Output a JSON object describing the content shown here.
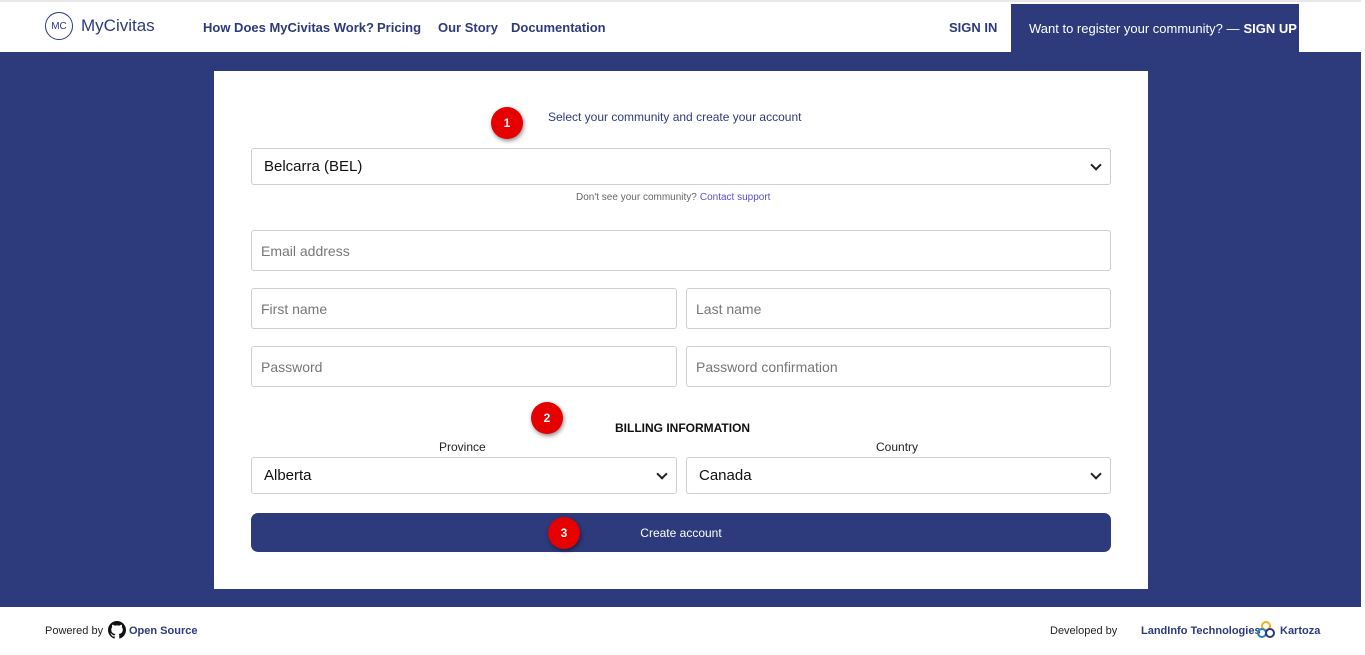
{
  "header": {
    "logo_initials": "MC",
    "logo_text": "MyCivitas",
    "nav": [
      "How Does MyCivitas Work?",
      "Pricing",
      "Our Story",
      "Documentation"
    ],
    "signin": "SIGN IN",
    "signup_prompt": "Want to register your community? —",
    "signup_label": "SIGN UP"
  },
  "form": {
    "badge1": "1",
    "badge2": "2",
    "badge3": "3",
    "title": "Select your community and create your account",
    "community_selected": "Belcarra (BEL)",
    "hint_text": "Don't see your community?",
    "hint_link": "Contact support",
    "email_placeholder": "Email address",
    "first_name_placeholder": "First name",
    "last_name_placeholder": "Last name",
    "password_placeholder": "Password",
    "password_confirm_placeholder": "Password confirmation",
    "billing_title": "BILLING INFORMATION",
    "province_label": "Province",
    "province_selected": "Alberta",
    "country_label": "Country",
    "country_selected": "Canada",
    "submit_label": "Create account"
  },
  "footer": {
    "powered_by": "Powered by",
    "open_source": "Open Source",
    "developed_by": "Developed by",
    "landinfo": "LandInfo Technologies",
    "kartoza": "Kartoza"
  },
  "colors": {
    "brand_navy": "#2d3a7c",
    "badge_red": "#e60000",
    "link_purple": "#5a4fcf"
  },
  "icons": [
    "github-icon",
    "kartoza-logo-icon",
    "chevron-down-icon"
  ]
}
